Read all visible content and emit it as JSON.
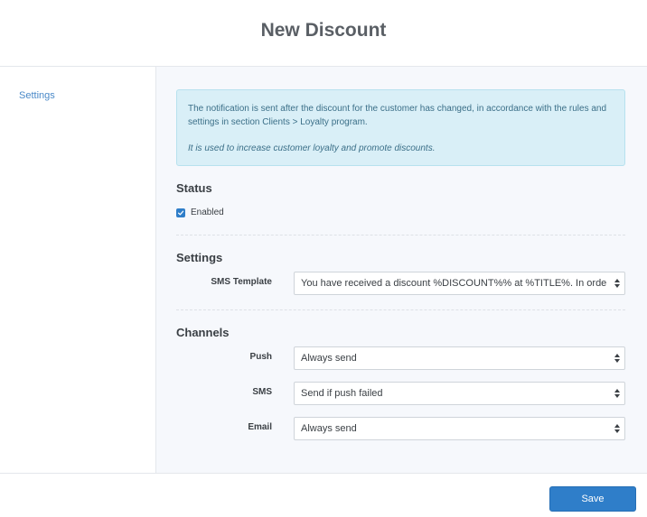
{
  "header": {
    "title": "New Discount"
  },
  "sidebar": {
    "items": [
      {
        "label": "Settings"
      }
    ]
  },
  "info": {
    "text": "The notification is sent after the discount for the customer has changed, in accordance with the rules and settings in section Clients > Loyalty program.",
    "note": "It is used to increase customer loyalty and promote discounts."
  },
  "status": {
    "title": "Status",
    "enabled_label": "Enabled",
    "enabled": true
  },
  "settings": {
    "title": "Settings",
    "sms_template_label": "SMS Template",
    "sms_template_value": "You have received a discount %DISCOUNT%% at %TITLE%. In order to use it, show this message"
  },
  "channels": {
    "title": "Channels",
    "push": {
      "label": "Push",
      "value": "Always send"
    },
    "sms": {
      "label": "SMS",
      "value": "Send if push failed"
    },
    "email": {
      "label": "Email",
      "value": "Always send"
    }
  },
  "footer": {
    "save_label": "Save"
  },
  "colors": {
    "accent": "#2f7ec9",
    "info_bg": "#d9eff7",
    "link": "#4a89c8"
  }
}
